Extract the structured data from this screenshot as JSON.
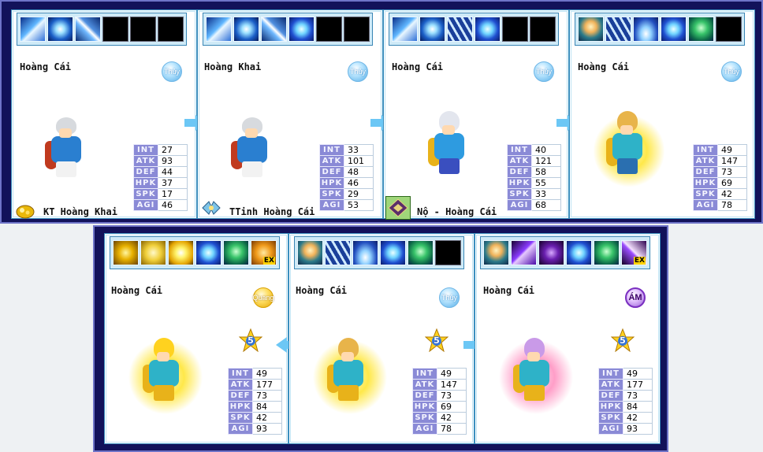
{
  "top_row": {
    "cards": [
      {
        "skills": [
          "ice-crystal",
          "ice-orb",
          "ice-blade",
          "empty",
          "empty",
          "empty"
        ],
        "name": "Hoàng Cái",
        "element": "Thủy",
        "stats": [
          [
            "INT",
            "27"
          ],
          [
            "ATK",
            "93"
          ],
          [
            "DEF",
            "44"
          ],
          [
            "HPK",
            "37"
          ],
          [
            "SPK",
            "17"
          ],
          [
            "AGI",
            "46"
          ]
        ],
        "item_icon": "gold-nugget-icon",
        "caption": "KT Hoàng Khai",
        "sprite": "gray-hair-general"
      },
      {
        "skills": [
          "ice-crystal",
          "ice-orb",
          "ice-blade",
          "water-swirl",
          "empty",
          "empty"
        ],
        "name": "Hoàng Khai",
        "element": "Thủy",
        "stats": [
          [
            "INT",
            "33"
          ],
          [
            "ATK",
            "101"
          ],
          [
            "DEF",
            "48"
          ],
          [
            "HPK",
            "46"
          ],
          [
            "SPK",
            "29"
          ],
          [
            "AGI",
            "53"
          ]
        ],
        "item_icon": "blue-wing-icon",
        "caption": "TTinh Hoàng Cái",
        "sprite": "gray-hair-general"
      },
      {
        "skills": [
          "ice-crystal",
          "ice-orb",
          "ice-slash",
          "water-swirl",
          "empty",
          "empty"
        ],
        "name": "Hoàng Cái",
        "element": "Thủy",
        "stats": [
          [
            "INT",
            "40"
          ],
          [
            "ATK",
            "121"
          ],
          [
            "DEF",
            "58"
          ],
          [
            "HPK",
            "55"
          ],
          [
            "SPK",
            "33"
          ],
          [
            "AGI",
            "68"
          ]
        ],
        "item_icon": "green-rune-icon",
        "caption": "Nộ - Hoàng Cái",
        "sprite": "silver-hair-warrior"
      },
      {
        "skills": [
          "portrait",
          "ice-slash",
          "water-wave",
          "water-swirl",
          "green-spirit",
          "empty"
        ],
        "name": "Hoàng Cái",
        "element": "Thủy",
        "stats": [
          [
            "INT",
            "49"
          ],
          [
            "ATK",
            "147"
          ],
          [
            "DEF",
            "73"
          ],
          [
            "HPK",
            "69"
          ],
          [
            "SPK",
            "42"
          ],
          [
            "AGI",
            "78"
          ]
        ],
        "sprite": "golden-hair-warrior"
      }
    ]
  },
  "bottom_row": {
    "cards": [
      {
        "skills": [
          "golden-fist",
          "golden-hand",
          "golden-burst",
          "water-swirl",
          "green-spirit",
          "golden-ex"
        ],
        "name": "Hoàng Cái",
        "element": "Quang",
        "star_level": "5",
        "stats": [
          [
            "INT",
            "49"
          ],
          [
            "ATK",
            "177"
          ],
          [
            "DEF",
            "73"
          ],
          [
            "HPK",
            "84"
          ],
          [
            "SPK",
            "42"
          ],
          [
            "AGI",
            "93"
          ]
        ],
        "sprite": "golden-hair-warrior"
      },
      {
        "skills": [
          "portrait",
          "ice-slash",
          "water-wave",
          "water-swirl",
          "green-spirit",
          "empty"
        ],
        "name": "Hoàng Cái",
        "element": "Thủy",
        "star_level": "5",
        "stats": [
          [
            "INT",
            "49"
          ],
          [
            "ATK",
            "147"
          ],
          [
            "DEF",
            "73"
          ],
          [
            "HPK",
            "69"
          ],
          [
            "SPK",
            "42"
          ],
          [
            "AGI",
            "78"
          ]
        ],
        "sprite": "golden-hair-warrior"
      },
      {
        "skills": [
          "portrait",
          "purple-slash",
          "dark-beam",
          "water-swirl",
          "green-spirit",
          "purple-ex"
        ],
        "name": "Hoàng Cái",
        "element": "ÁM",
        "star_level": "5",
        "stats": [
          [
            "INT",
            "49"
          ],
          [
            "ATK",
            "177"
          ],
          [
            "DEF",
            "73"
          ],
          [
            "HPK",
            "84"
          ],
          [
            "SPK",
            "42"
          ],
          [
            "AGI",
            "93"
          ]
        ],
        "sprite": "violet-hair-warrior"
      }
    ]
  },
  "ex_label": "EX",
  "colors": {
    "frame": "#12125a",
    "card_border": "#3b8fbe",
    "stat_label_bg": "#8a8ad6",
    "arrow": "#6cc7f5"
  }
}
